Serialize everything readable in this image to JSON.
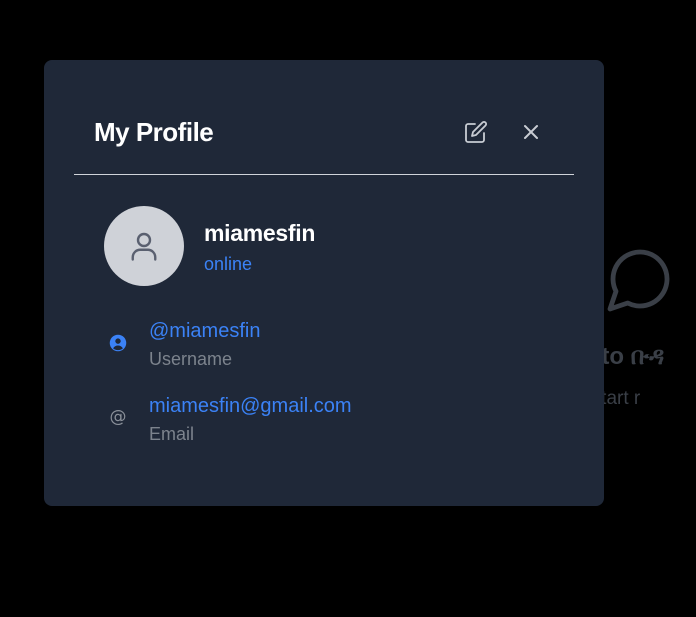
{
  "background": {
    "welcome_fragment": "me to ቡዳ",
    "subtitle_fragment": "t to start r"
  },
  "modal": {
    "title": "My Profile",
    "edit_icon": "edit-icon",
    "close_icon": "close-icon"
  },
  "profile": {
    "display_name": "miamesfin",
    "status": "online",
    "avatar_icon": "user-icon"
  },
  "details": {
    "username": {
      "icon": "user-circle-icon",
      "value": "@miamesfin",
      "label": "Username"
    },
    "email": {
      "icon": "at-icon",
      "glyph": "@",
      "value": "miamesfin@gmail.com",
      "label": "Email"
    }
  },
  "colors": {
    "modal_bg": "#1f2838",
    "accent": "#3b82f6",
    "muted": "#7c838d",
    "page_bg": "#000000"
  }
}
